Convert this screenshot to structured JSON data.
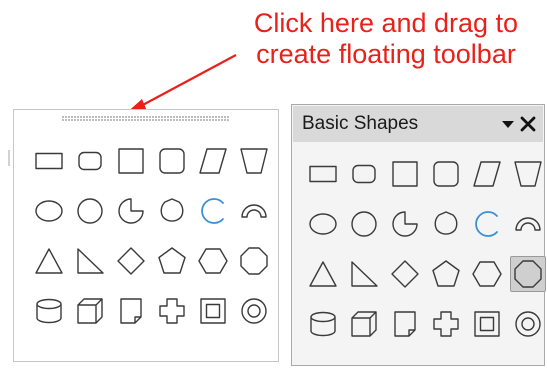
{
  "annotation": {
    "lines": [
      "Click here and drag to",
      "create floating toolbar"
    ],
    "color": "#e8221b"
  },
  "docked_toolbar": {
    "grip_icon": "drag-handle-icon"
  },
  "floating_toolbar": {
    "title": "Basic Shapes",
    "menu_icon": "dropdown-arrow-icon",
    "close_icon": "close-icon"
  },
  "shapes": [
    "rectangle",
    "rectangle-rounded",
    "square",
    "square-rounded",
    "parallelogram",
    "trapezoid",
    "ellipse",
    "circle",
    "circle-pie",
    "block-arc-circle",
    "arc",
    "block-arc",
    "isosceles-triangle",
    "right-triangle",
    "diamond",
    "pentagon",
    "hexagon",
    "octagon",
    "can",
    "cube",
    "folded-corner",
    "cross",
    "frame",
    "ring"
  ],
  "selected_floating_shape": "octagon",
  "colors": {
    "stroke": "#3a3a3a",
    "arc_accent": "#3b8fd6"
  }
}
